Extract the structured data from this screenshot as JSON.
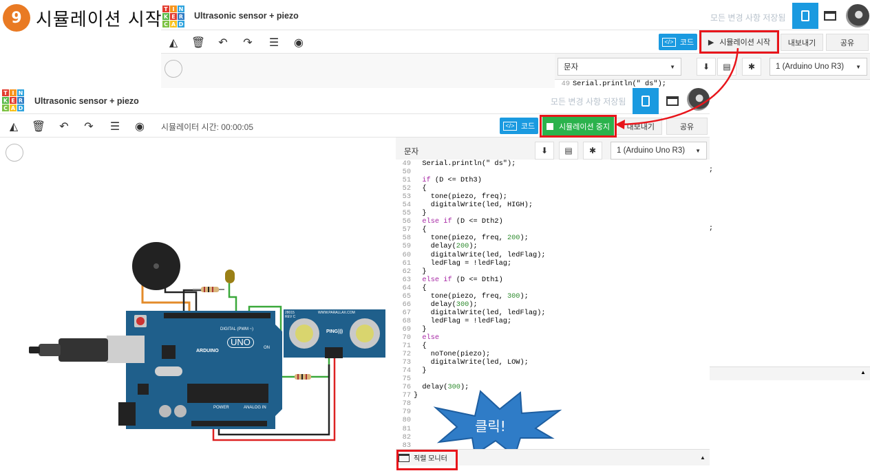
{
  "step": {
    "number": "9",
    "title": "시뮬레이션 시작"
  },
  "logo_letters": [
    "T",
    "I",
    "N",
    "K",
    "E",
    "R",
    "C",
    "A",
    "D"
  ],
  "back_window": {
    "project_name": "Ultrasonic sensor + piezo",
    "saved_status": "모든 변경 사항 저장됨",
    "code_label": "코드",
    "sim_start_label": "시뮬레이션 시작",
    "export_label": "내보내기",
    "share_label": "공유",
    "text_mode": "문자",
    "device_select": "1 (Arduino Uno R3)",
    "code_line_49": "Serial.println(\" ds\");",
    "line_numbers": [
      "49",
      "50"
    ]
  },
  "front_window": {
    "project_name": "Ultrasonic sensor + piezo",
    "saved_status": "모든 변경 사항 저장됨",
    "sim_time": "시뮬레이터 시간: 00:00:05",
    "code_label": "코드",
    "sim_stop_label": "시뮬레이션 중지",
    "export_label": "내보내기",
    "share_label": "공유",
    "text_mode": "문자",
    "device_select": "1 (Arduino Uno R3)",
    "serial_monitor_label": "직렬 모니터"
  },
  "code_lines": [
    {
      "n": "49",
      "t": "  Serial.println(\" ds\");"
    },
    {
      "n": "50",
      "t": ""
    },
    {
      "n": "51",
      "t": "  if (D <= Dth3)"
    },
    {
      "n": "52",
      "t": "  {"
    },
    {
      "n": "53",
      "t": "    tone(piezo, freq);"
    },
    {
      "n": "54",
      "t": "    digitalWrite(led, HIGH);"
    },
    {
      "n": "55",
      "t": "  }"
    },
    {
      "n": "56",
      "t": "  else if (D <= Dth2)"
    },
    {
      "n": "57",
      "t": "  {"
    },
    {
      "n": "58",
      "t": "    tone(piezo, freq, 200);"
    },
    {
      "n": "59",
      "t": "    delay(200);"
    },
    {
      "n": "60",
      "t": "    digitalWrite(led, ledFlag);"
    },
    {
      "n": "61",
      "t": "    ledFlag = !ledFlag;"
    },
    {
      "n": "62",
      "t": "  }"
    },
    {
      "n": "63",
      "t": "  else if (D <= Dth1)"
    },
    {
      "n": "64",
      "t": "  {"
    },
    {
      "n": "65",
      "t": "    tone(piezo, freq, 300);"
    },
    {
      "n": "66",
      "t": "    delay(300);"
    },
    {
      "n": "67",
      "t": "    digitalWrite(led, ledFlag);"
    },
    {
      "n": "68",
      "t": "    ledFlag = !ledFlag;"
    },
    {
      "n": "69",
      "t": "  }"
    },
    {
      "n": "70",
      "t": "  else"
    },
    {
      "n": "71",
      "t": "  {"
    },
    {
      "n": "72",
      "t": "    noTone(piezo);"
    },
    {
      "n": "73",
      "t": "    digitalWrite(led, LOW);"
    },
    {
      "n": "74",
      "t": "  }"
    },
    {
      "n": "75",
      "t": ""
    },
    {
      "n": "76",
      "t": "  delay(300);"
    },
    {
      "n": "77",
      "t": "}"
    },
    {
      "n": "78",
      "t": ""
    },
    {
      "n": "79",
      "t": ""
    },
    {
      "n": "80",
      "t": ""
    },
    {
      "n": "81",
      "t": ""
    },
    {
      "n": "82",
      "t": ""
    },
    {
      "n": "83",
      "t": ""
    }
  ],
  "callout": "클릭!",
  "board": {
    "brand": "ARDUINO",
    "model": "UNO",
    "digital_label": "DIGITAL (PWM ~)",
    "power_label": "POWER",
    "analog_label": "ANALOG IN",
    "on_label": "ON",
    "sensor_brand": "WWW.PARALLAX.COM",
    "sensor_model": "PING)))",
    "sensor_code": "28015",
    "sensor_rev": "REV C"
  },
  "colors": {
    "accent_blue": "#1a9ae0",
    "stop_green": "#2bb24c",
    "highlight_red": "#e8151b",
    "step_orange": "#e97a23",
    "callout_blue": "#2f7cc7",
    "board_blue": "#1f5f8b"
  }
}
